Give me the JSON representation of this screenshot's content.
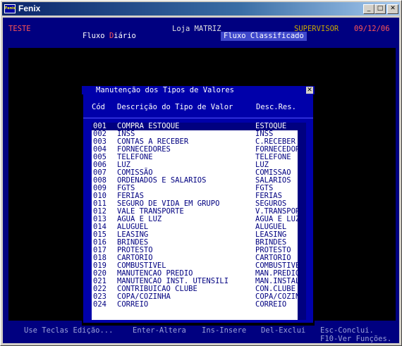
{
  "window": {
    "icon_label": "Fenix",
    "title": "Fenix",
    "controls": {
      "minimize": "_",
      "maximize": "□",
      "close": "✕"
    }
  },
  "header": {
    "user": "TESTE",
    "store": "Loja MATRIZ",
    "role": "SUPERVISOR",
    "date": "09/12/06",
    "menu_left_a": "Fluxo ",
    "menu_left_hot": "D",
    "menu_left_b": "iário",
    "menu_active": "Fluxo Classificado"
  },
  "dialog": {
    "title": "Manutenção dos Tipos de Valores",
    "close": "✕",
    "columns": {
      "code": "Cód",
      "description": "Descrição do Tipo de Valor",
      "short": "Desc.Res."
    },
    "rows": [
      {
        "code": "001",
        "description": "COMPRA ESTOQUE",
        "short": "ESTOQUE"
      },
      {
        "code": "002",
        "description": "INSS",
        "short": "INSS"
      },
      {
        "code": "003",
        "description": "CONTAS A RECEBER",
        "short": "C.RECEBER"
      },
      {
        "code": "004",
        "description": "FORNECEDORES",
        "short": "FORNECEDOR"
      },
      {
        "code": "005",
        "description": "TELEFONE",
        "short": "TELEFONE"
      },
      {
        "code": "006",
        "description": "LUZ",
        "short": "LUZ"
      },
      {
        "code": "007",
        "description": "COMISSÃO",
        "short": "COMISSAO"
      },
      {
        "code": "008",
        "description": "ORDENADOS E SALARIOS",
        "short": "SALARIOS"
      },
      {
        "code": "009",
        "description": "FGTS",
        "short": "FGTS"
      },
      {
        "code": "010",
        "description": "FERIAS",
        "short": "FERIAS"
      },
      {
        "code": "011",
        "description": "SEGURO DE VIDA EM GRUPO",
        "short": "SEGUROS"
      },
      {
        "code": "012",
        "description": "VALE TRANSPORTE",
        "short": "V.TRANSPOR"
      },
      {
        "code": "013",
        "description": "AGUA E LUZ",
        "short": "AGUA E LUZ"
      },
      {
        "code": "014",
        "description": "ALUGUEL",
        "short": "ALUGUEL"
      },
      {
        "code": "015",
        "description": "LEASING",
        "short": "LEASING"
      },
      {
        "code": "016",
        "description": "BRINDES",
        "short": "BRINDES"
      },
      {
        "code": "017",
        "description": "PROTESTO",
        "short": "PROTESTO"
      },
      {
        "code": "018",
        "description": "CARTORIO",
        "short": "CARTORIO"
      },
      {
        "code": "019",
        "description": "COMBUSTIVEL",
        "short": "COMBUSTIVEL"
      },
      {
        "code": "020",
        "description": "MANUTENCAO PREDIO",
        "short": "MAN.PREDIO"
      },
      {
        "code": "021",
        "description": "MANUTENCAO INST. UTENSILI",
        "short": "MAN.INSTAL"
      },
      {
        "code": "022",
        "description": "CONTRIBUICAO CLUBE",
        "short": "CON.CLUBE"
      },
      {
        "code": "023",
        "description": "COPA/COZINHA",
        "short": "COPA/COZIN"
      },
      {
        "code": "024",
        "description": "CORREIO",
        "short": "CORREIO"
      }
    ]
  },
  "statusbar": {
    "hint_edit": "Use Teclas Edição...",
    "enter": "Enter-Altera",
    "ins": "Ins-Insere",
    "del": "Del-Exclui",
    "esc": "Esc-Conclui.",
    "f10": "F10-Ver Funções."
  },
  "colors": {
    "background": "#000080",
    "dialog": "#0000aa",
    "selection": "#000080",
    "user": "#ff5555",
    "role": "#c8a800",
    "date": "#ff5555",
    "status": "#9aa0d8"
  }
}
